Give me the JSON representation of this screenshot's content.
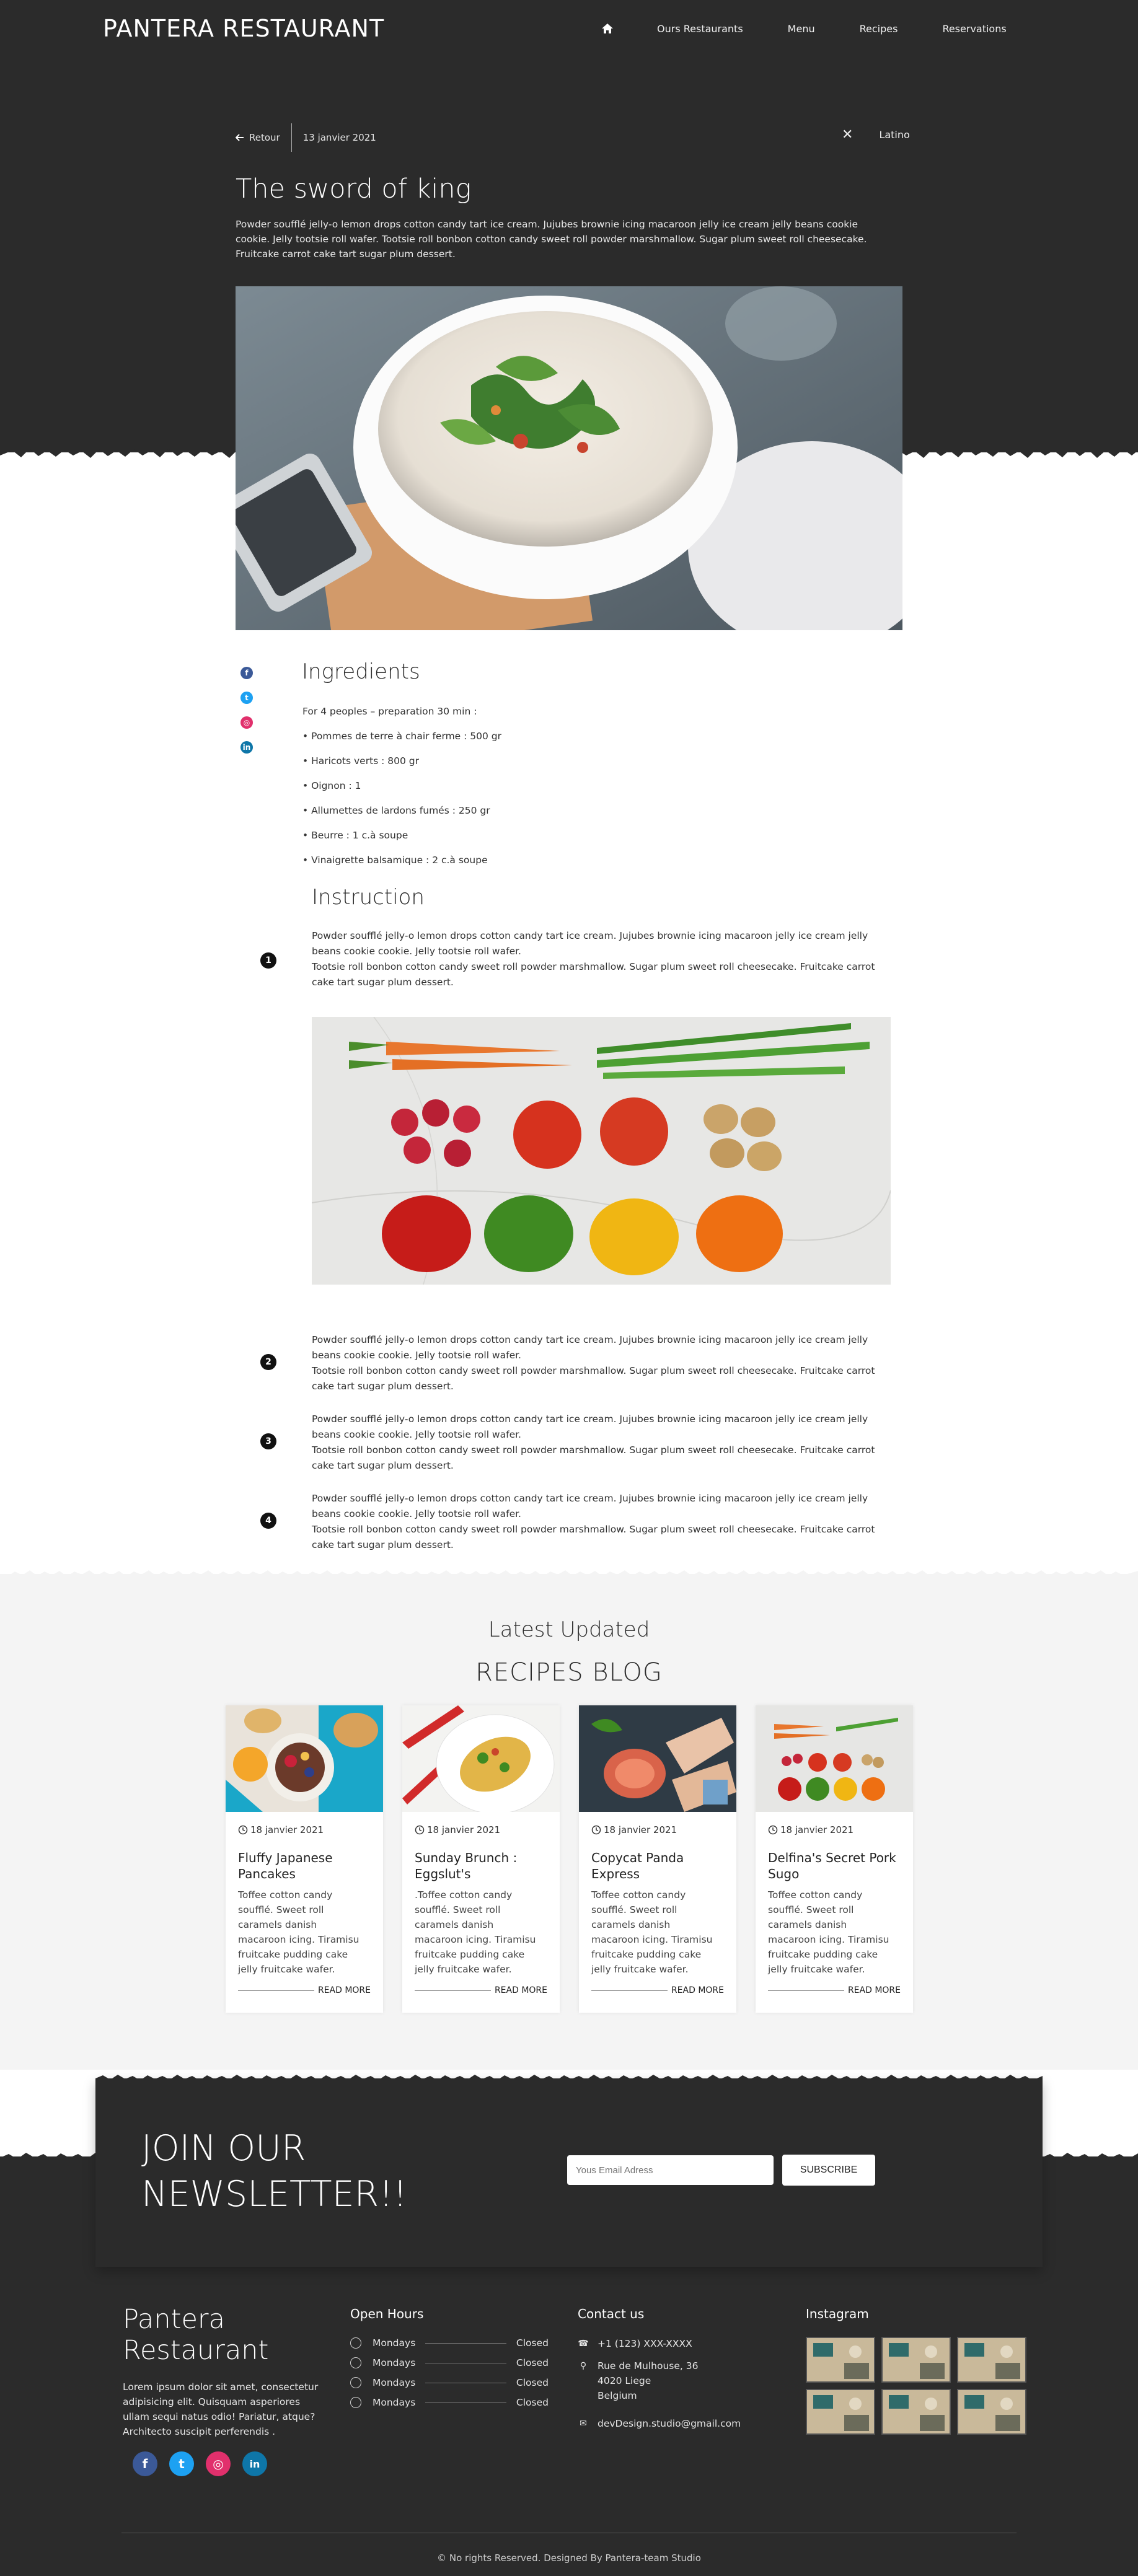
{
  "brand": "PANTERA RESTAURANT",
  "nav": {
    "home_icon": "home-icon",
    "items": [
      "Ours Restaurants",
      "Menu",
      "Recipes",
      "Reservations"
    ]
  },
  "article": {
    "back_label": "Retour",
    "date": "13 janvier 2021",
    "close_glyph": "✕",
    "language": "Latino",
    "title": "The sword of king",
    "intro": "Powder soufflé jelly-o lemon drops cotton candy tart ice cream. Jujubes brownie icing macaroon jelly ice cream jelly beans cookie cookie. Jelly tootsie roll wafer. Tootsie roll bonbon cotton candy sweet roll powder marshmallow. Sugar plum sweet roll cheesecake. Fruitcake carrot cake tart sugar plum dessert."
  },
  "side_social": [
    "facebook-icon",
    "twitter-icon",
    "instagram-icon",
    "linkedin-icon"
  ],
  "ingredients": {
    "title": "Ingredients",
    "items": [
      "For 4 peoples – preparation 30 min :",
      "• Pommes de terre à chair ferme : 500 gr",
      "• Haricots verts : 800 gr",
      "• Oignon : 1",
      "• Allumettes de lardons fumés : 250 gr",
      "• Beurre : 1 c.à soupe",
      "• Vinaigrette balsamique : 2 c.à soupe"
    ]
  },
  "instruction": {
    "title": "Instruction",
    "steps": [
      {
        "num": "1",
        "text_a": "Powder soufflé jelly-o lemon drops cotton candy tart ice cream. Jujubes brownie icing macaroon jelly ice cream jelly beans cookie cookie. Jelly tootsie roll wafer.",
        "text_b": "Tootsie roll bonbon cotton candy sweet roll powder marshmallow. Sugar plum sweet roll cheesecake. Fruitcake carrot cake tart sugar plum dessert."
      },
      {
        "num": "2",
        "text_a": "Powder soufflé jelly-o lemon drops cotton candy tart ice cream. Jujubes brownie icing macaroon jelly ice cream jelly beans cookie cookie. Jelly tootsie roll wafer.",
        "text_b": "Tootsie roll bonbon cotton candy sweet roll powder marshmallow. Sugar plum sweet roll cheesecake. Fruitcake carrot cake tart sugar plum dessert."
      },
      {
        "num": "3",
        "text_a": "Powder soufflé jelly-o lemon drops cotton candy tart ice cream. Jujubes brownie icing macaroon jelly ice cream jelly beans cookie cookie. Jelly tootsie roll wafer.",
        "text_b": "Tootsie roll bonbon cotton candy sweet roll powder marshmallow. Sugar plum sweet roll cheesecake. Fruitcake carrot cake tart sugar plum dessert."
      },
      {
        "num": "4",
        "text_a": "Powder soufflé jelly-o lemon drops cotton candy tart ice cream. Jujubes brownie icing macaroon jelly ice cream jelly beans cookie cookie. Jelly tootsie roll wafer.",
        "text_b": "Tootsie roll bonbon cotton candy sweet roll powder marshmallow. Sugar plum sweet roll cheesecake. Fruitcake carrot cake tart sugar plum dessert."
      }
    ]
  },
  "blog": {
    "latest": "Latest Updated",
    "heading": "RECIPES BLOG",
    "cards": [
      {
        "date": "18 janvier 2021",
        "title": "Fluffy Japanese Pancakes",
        "desc": "Toffee cotton candy soufflé. Sweet roll caramels danish macaroon icing. Tiramisu fruitcake pudding cake jelly fruitcake wafer.",
        "more": "READ MORE"
      },
      {
        "date": "18 janvier 2021",
        "title": "Sunday Brunch : Eggslut's",
        "desc": ".Toffee cotton candy soufflé. Sweet roll caramels danish macaroon icing. Tiramisu fruitcake pudding cake jelly fruitcake wafer.",
        "more": "READ MORE"
      },
      {
        "date": "18 janvier 2021",
        "title": "Copycat Panda Express",
        "desc": "Toffee cotton candy soufflé. Sweet roll caramels danish macaroon icing. Tiramisu fruitcake pudding cake jelly fruitcake wafer.",
        "more": "READ MORE"
      },
      {
        "date": "18 janvier 2021",
        "title": "Delfina's Secret Pork Sugo",
        "desc": "Toffee cotton candy soufflé. Sweet roll caramels danish macaroon icing. Tiramisu fruitcake pudding cake jelly fruitcake wafer.",
        "more": "READ MORE"
      }
    ]
  },
  "newsletter": {
    "title": "JOIN OUR NEWSLETTER!!",
    "placeholder": "Yous Email Adress",
    "button": "SUBSCRIBE"
  },
  "footer": {
    "brand": "Pantera Restaurant",
    "about": "Lorem ipsum dolor sit amet, consectetur adipisicing elit. Quisquam asperiores ullam sequi natus odio! Pariatur, atque? Architecto suscipit perferendis .",
    "social": [
      "facebook-icon",
      "twitter-icon",
      "instagram-icon",
      "linkedin-icon"
    ],
    "hours_title": "Open Hours",
    "hours": [
      {
        "day": "Mondays",
        "status": "Closed"
      },
      {
        "day": "Mondays",
        "status": "Closed"
      },
      {
        "day": "Mondays",
        "status": "Closed"
      },
      {
        "day": "Mondays",
        "status": "Closed"
      }
    ],
    "contact_title": "Contact us",
    "phone": "+1 (123) XXX-XXXX",
    "address_line1": "Rue de Mulhouse, 36",
    "address_line2": "4020 Liege",
    "address_line3": "Belgium",
    "email": "devDesign.studio@gmail.com",
    "instagram_title": "Instagram",
    "copyright": "© No rights Reserved. Designed By Pantera-team Studio"
  },
  "colors": {
    "dark": "#2b2b2b",
    "light_bg": "#f4f4f4",
    "facebook": "#3b5998",
    "twitter": "#1da1f2",
    "instagram": "#e1306c",
    "linkedin": "#0e76a8"
  }
}
